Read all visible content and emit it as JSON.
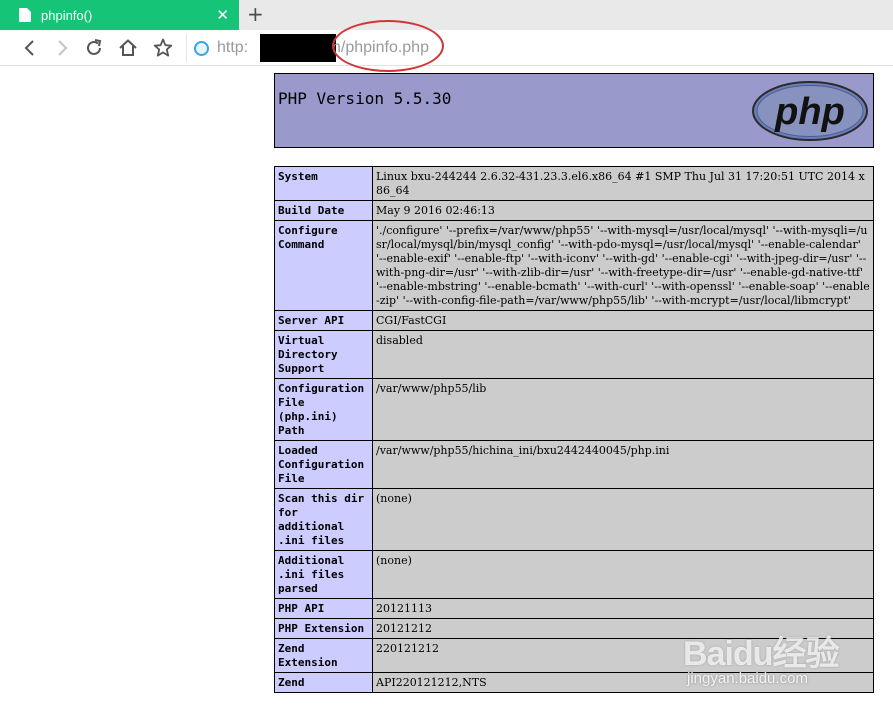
{
  "browser": {
    "tab_title": "phpinfo()",
    "tab_close": "✕",
    "new_tab": "+",
    "url_prefix": "http:",
    "url_suffix": "n/phpinfo.php",
    "colors": {
      "tab_active": "#16c477",
      "highlight": "#d03636"
    }
  },
  "php": {
    "version_title": "PHP Version 5.5.30",
    "logo_text": "php"
  },
  "info_rows": [
    {
      "key": "System",
      "value": "Linux bxu-244244 2.6.32-431.23.3.el6.x86_64 #1 SMP Thu Jul 31 17:20:51 UTC 2014 x86_64"
    },
    {
      "key": "Build Date",
      "value": "May 9 2016 02:46:13"
    },
    {
      "key": "Configure Command",
      "value": "'./configure' '--prefix=/var/www/php55' '--with-mysql=/usr/local/mysql' '--with-mysqli=/usr/local/mysql/bin/mysql_config' '--with-pdo-mysql=/usr/local/mysql' '--enable-calendar' '--enable-exif' '--enable-ftp' '--with-iconv' '--with-gd' '--enable-cgi' '--with-jpeg-dir=/usr' '--with-png-dir=/usr' '--with-zlib-dir=/usr' '--with-freetype-dir=/usr' '--enable-gd-native-ttf' '--enable-mbstring' '--enable-bcmath' '--with-curl' '--with-openssl' '--enable-soap' '--enable-zip' '--with-config-file-path=/var/www/php55/lib' '--with-mcrypt=/usr/local/libmcrypt'"
    },
    {
      "key": "Server API",
      "value": "CGI/FastCGI"
    },
    {
      "key": "Virtual Directory Support",
      "value": "disabled"
    },
    {
      "key": "Configuration File (php.ini) Path",
      "value": "/var/www/php55/lib"
    },
    {
      "key": "Loaded Configuration File",
      "value": "/var/www/php55/hichina_ini/bxu2442440045/php.ini"
    },
    {
      "key": "Scan this dir for additional .ini files",
      "value": "(none)"
    },
    {
      "key": "Additional .ini files parsed",
      "value": "(none)"
    },
    {
      "key": "PHP API",
      "value": "20121113"
    },
    {
      "key": "PHP Extension",
      "value": "20121212"
    },
    {
      "key": "Zend Extension",
      "value": "220121212"
    },
    {
      "key": "Zend",
      "value": "API220121212,NTS"
    }
  ],
  "watermark": {
    "brand": "Baidu经验",
    "url": "jingyan.baidu.com"
  }
}
